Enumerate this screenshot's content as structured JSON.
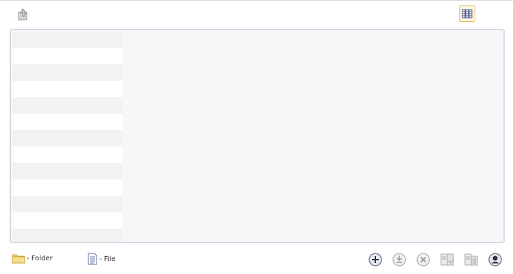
{
  "toolbar": {
    "up_icon": "up-folder-icon",
    "view_icon": "column-view-icon",
    "accent_color": "#e3b55a"
  },
  "panel": {
    "rows": 14
  },
  "legend": {
    "folder_label": "- Folder",
    "file_label": "- File"
  },
  "actions": [
    {
      "name": "add-button",
      "icon": "plus-circle-icon",
      "enabled": true
    },
    {
      "name": "download-button",
      "icon": "download-icon",
      "enabled": false
    },
    {
      "name": "delete-button",
      "icon": "close-circle-icon",
      "enabled": false
    },
    {
      "name": "move-button",
      "icon": "move-icon",
      "enabled": false
    },
    {
      "name": "copy-button",
      "icon": "copy-icon",
      "enabled": false
    },
    {
      "name": "user-button",
      "icon": "user-circle-icon",
      "enabled": true
    }
  ]
}
